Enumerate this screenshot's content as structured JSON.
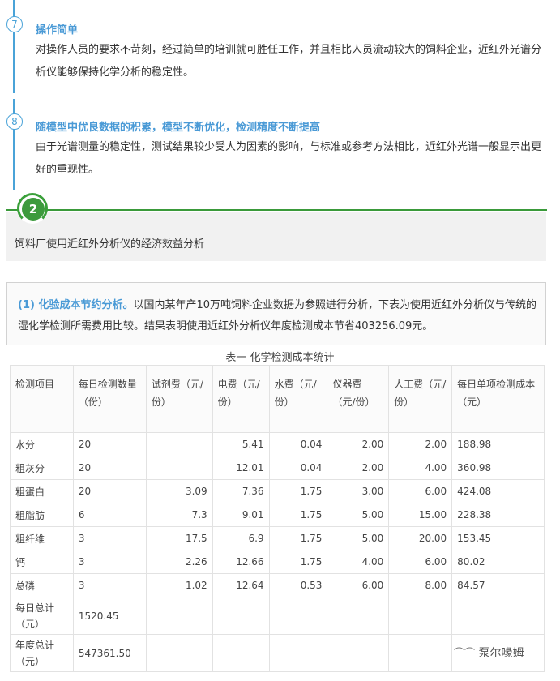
{
  "items": [
    {
      "num": "7",
      "title": "操作简单",
      "body": "对操作人员的要求不苛刻，经过简单的培训就可胜任工作，并且相比人员流动较大的饲料企业，近红外光谱分析仪能够保持化学分析的稳定性。"
    },
    {
      "num": "8",
      "title": "随模型中优良数据的积累，模型不断优化，检测精度不断提高",
      "body": "由于光谱测量的稳定性，测试结果较少受人为因素的影响，与标准或参考方法相比，近红外光谱一般显示出更好的重现性。"
    }
  ],
  "section2": {
    "badge": "2",
    "title": "饲料厂使用近红外分析仪的经济效益分析"
  },
  "analysis": {
    "heading": "(1) 化验成本节约分析。",
    "body": "以国内某年产10万吨饲料企业数据为参照进行分析，下表为使用近红外分析仪与传统的湿化学检测所需费用比较。结果表明使用近红外分析仪年度检测成本节省403256.09元。"
  },
  "table": {
    "title": "表一 化学检测成本统计",
    "headers": [
      "检测项目",
      "每日检测数量（份）",
      "试剂费（元/份）",
      "电费（元/份）",
      "水费（元/份）",
      "仪器费（元/份）",
      "人工费（元/份）",
      "每日单项检测成本（元）"
    ],
    "rows": [
      [
        "水分",
        "20",
        "",
        "5.41",
        "0.04",
        "2.00",
        "2.00",
        "188.98"
      ],
      [
        "粗灰分",
        "20",
        "",
        "12.01",
        "0.04",
        "2.00",
        "4.00",
        "360.98"
      ],
      [
        "粗蛋白",
        "20",
        "3.09",
        "7.36",
        "1.75",
        "3.00",
        "6.00",
        "424.08"
      ],
      [
        "粗脂肪",
        "6",
        "7.3",
        "9.01",
        "1.75",
        "5.00",
        "15.00",
        "228.38"
      ],
      [
        "粗纤维",
        "3",
        "17.5",
        "6.9",
        "1.75",
        "5.00",
        "20.00",
        "153.45"
      ],
      [
        "钙",
        "3",
        "2.26",
        "12.66",
        "1.75",
        "4.00",
        "6.00",
        "80.02"
      ],
      [
        "总磷",
        "3",
        "1.02",
        "12.64",
        "0.53",
        "6.00",
        "8.00",
        "84.57"
      ]
    ],
    "totals": [
      {
        "label": "每日总计（元）",
        "value": "1520.45"
      },
      {
        "label": "年度总计（元）",
        "value": "547361.50"
      }
    ]
  },
  "watermark": "泵尔喙姆"
}
